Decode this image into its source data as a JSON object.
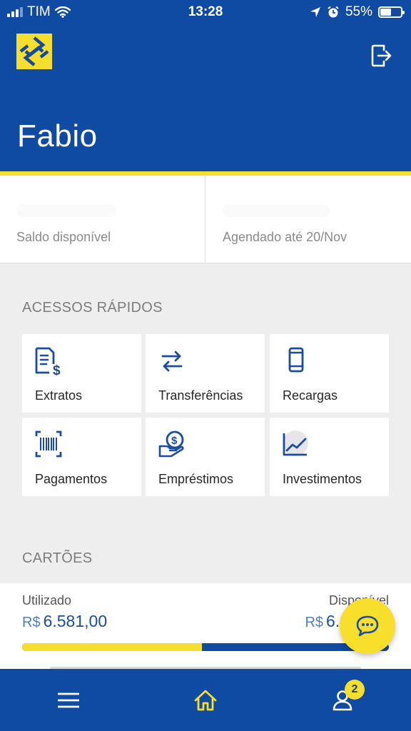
{
  "status_bar": {
    "carrier": "TIM",
    "time": "13:28",
    "battery": "55%",
    "battery_level": 0.55
  },
  "header": {
    "user_name": "Fabio",
    "logo_icon": "banco-do-brasil-logo",
    "logout_icon": "logout-icon"
  },
  "balance": {
    "available_label": "Saldo disponível",
    "scheduled_label": "Agendado até 20/Nov"
  },
  "quick_access": {
    "title": "ACESSOS RÁPIDOS",
    "items": [
      {
        "label": "Extratos",
        "icon": "statement-icon"
      },
      {
        "label": "Transferências",
        "icon": "transfer-icon"
      },
      {
        "label": "Recargas",
        "icon": "phone-icon"
      },
      {
        "label": "Pagamentos",
        "icon": "barcode-icon"
      },
      {
        "label": "Empréstimos",
        "icon": "loan-icon"
      },
      {
        "label": "Investimentos",
        "icon": "chart-icon"
      }
    ]
  },
  "cards": {
    "title": "CARTÕES",
    "used_label": "Utilizado",
    "available_label": "Disponível",
    "currency": "R$",
    "used_value": "6.581,00",
    "available_value": "6.8",
    "used_fraction": 0.49
  },
  "nav": {
    "badge_count": "2"
  },
  "colors": {
    "brand_blue": "#0f4aa3",
    "brand_yellow": "#f5df2c"
  }
}
